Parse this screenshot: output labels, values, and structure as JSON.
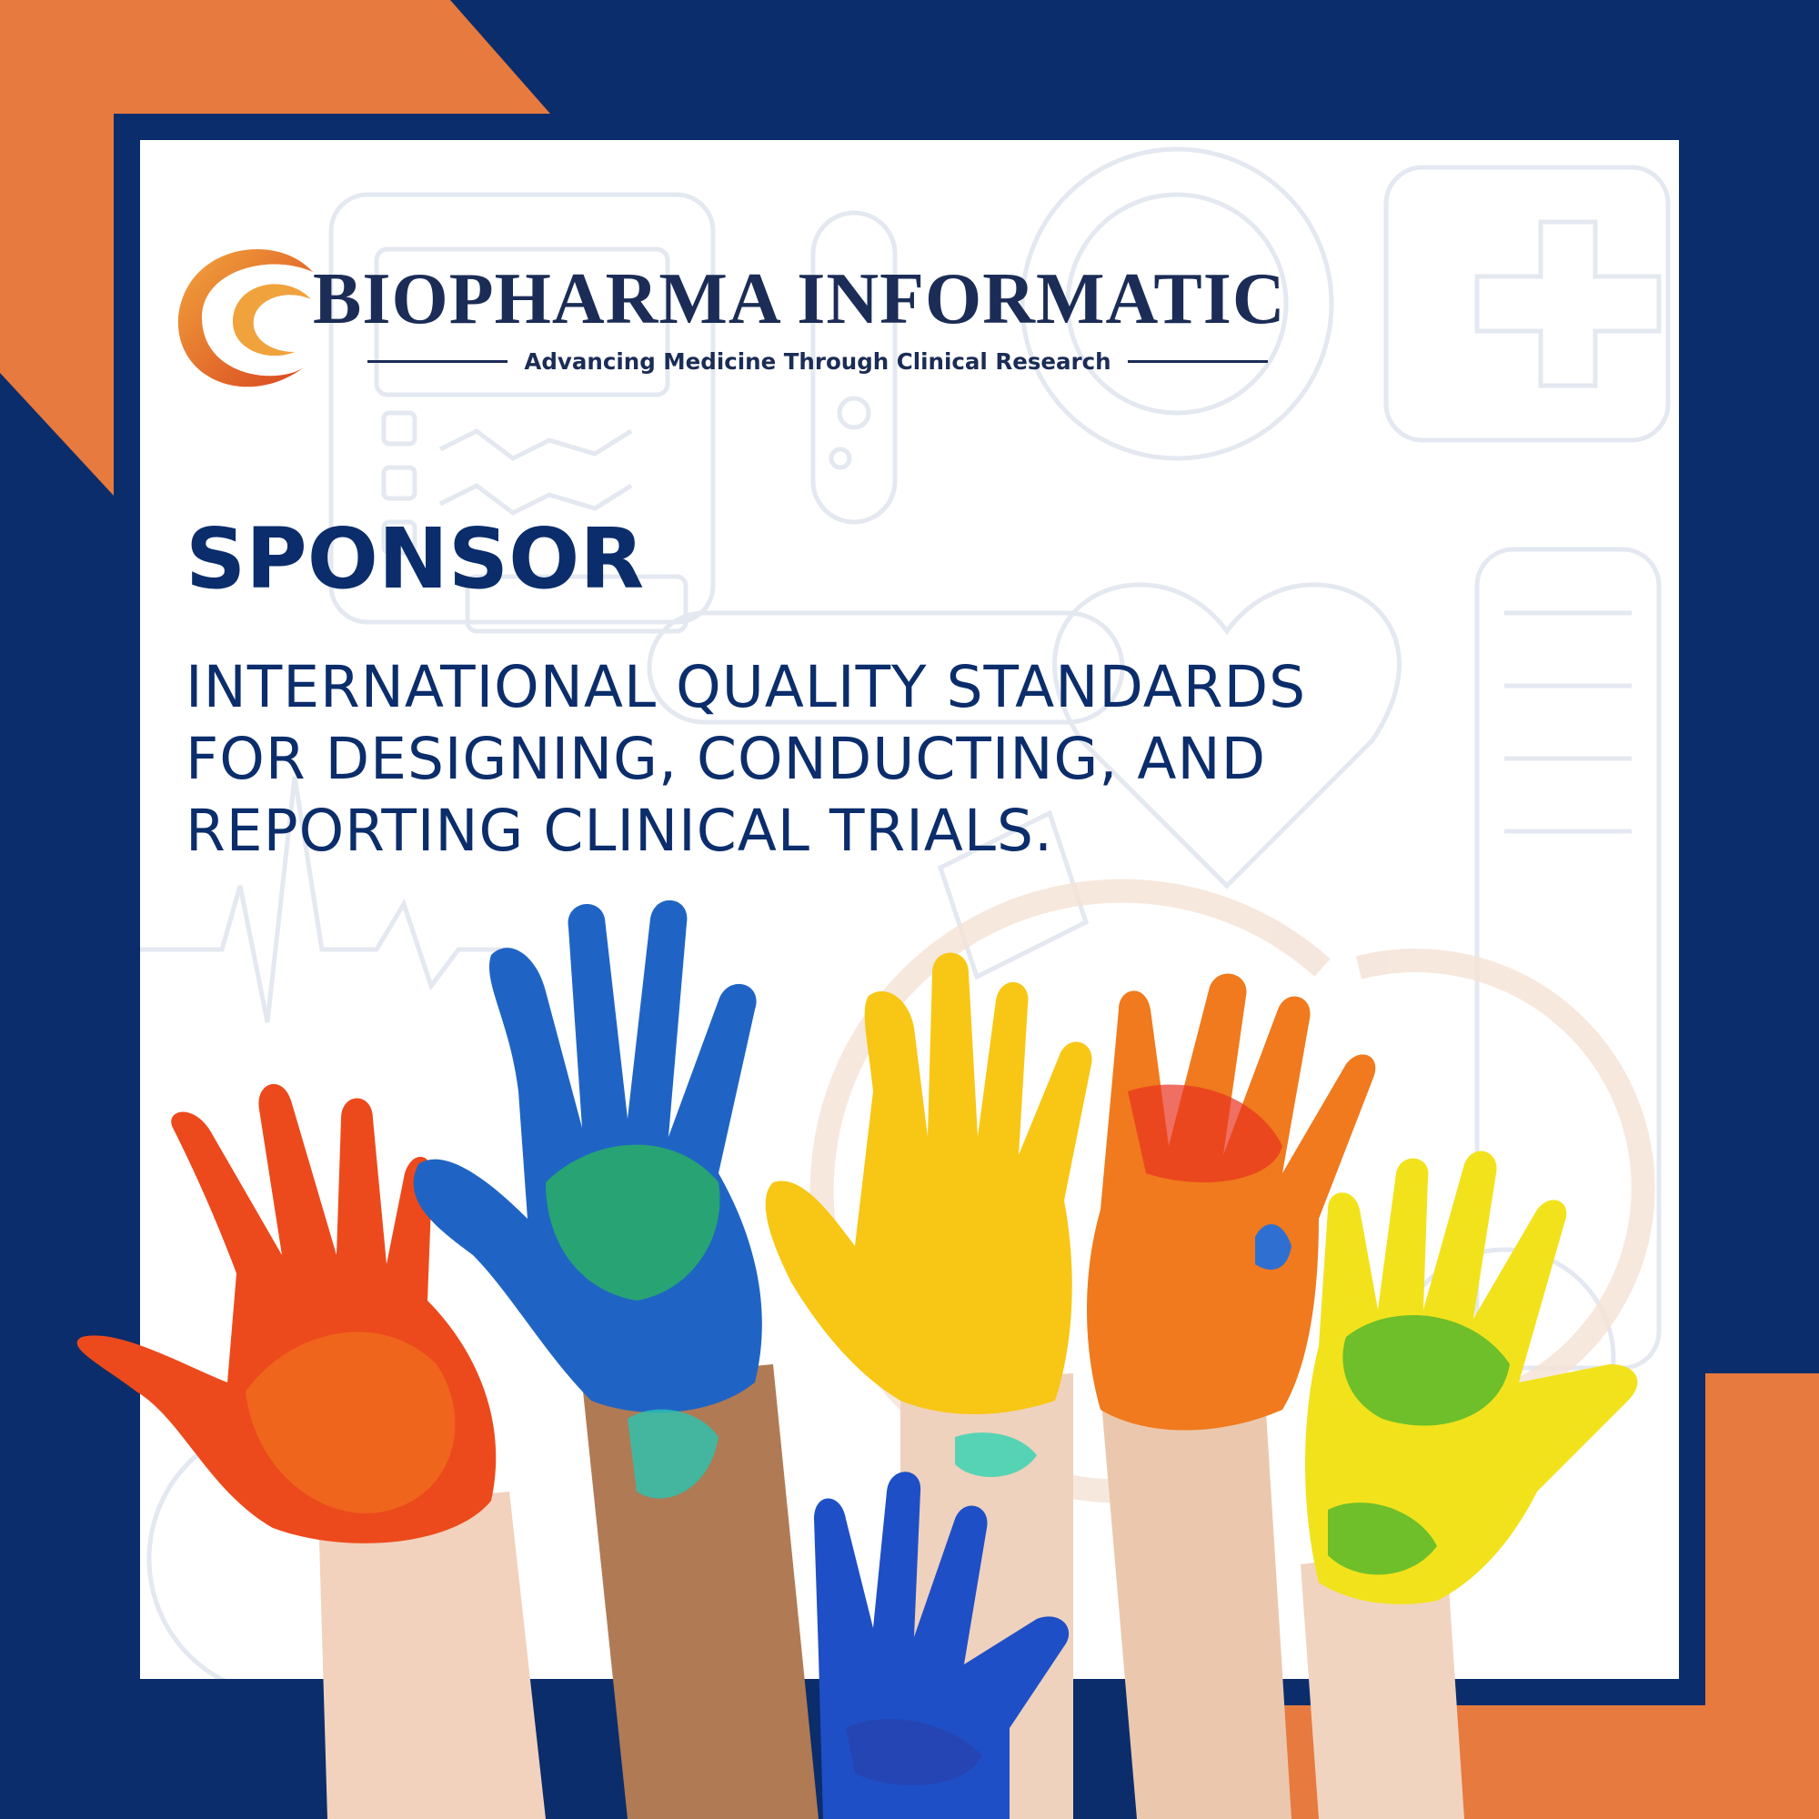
{
  "logo": {
    "brand_name": "BIOPHARMA INFORMATIC",
    "tagline": "Advancing Medicine Through Clinical Research"
  },
  "heading": "SPONSOR",
  "description_lines": [
    "INTERNATIONAL QUALITY STANDARDS",
    "FOR DESIGNING, CONDUCTING, AND",
    "REPORTING CLINICAL TRIALS."
  ],
  "colors": {
    "navy": "#0b2d6b",
    "orange": "#e77a3e",
    "white": "#ffffff"
  },
  "image": {
    "hands": [
      "red-painted-hand",
      "blue-green-painted-hand",
      "yellow-painted-hand",
      "orange-red-painted-hand",
      "green-yellow-painted-hand",
      "small-blue-painted-hand"
    ]
  }
}
